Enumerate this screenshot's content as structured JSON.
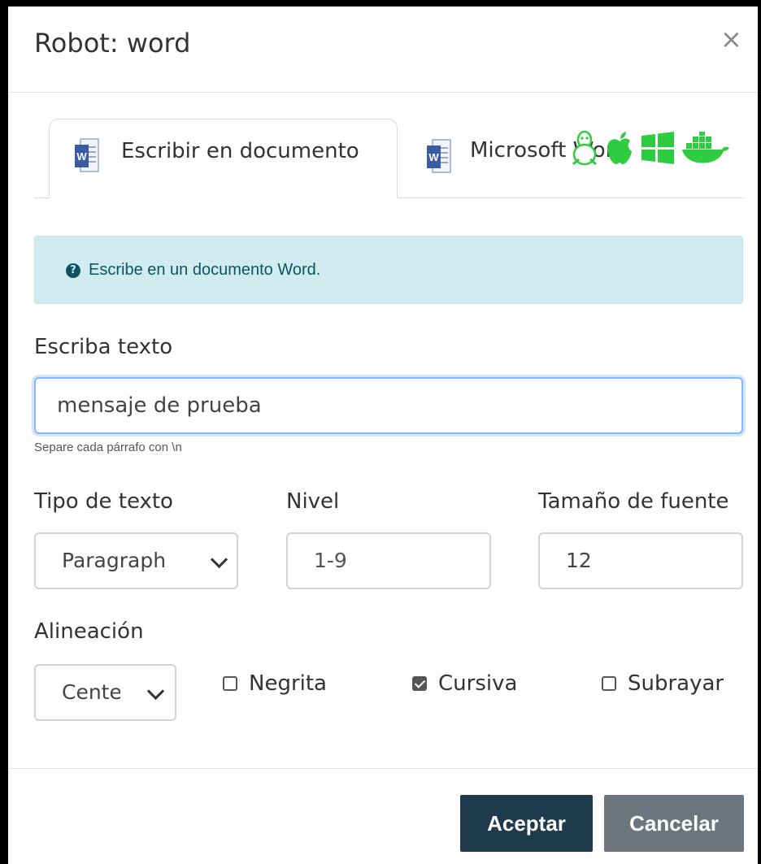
{
  "modal": {
    "title": "Robot: word",
    "close_label": "×"
  },
  "tabs": [
    {
      "label": "Escribir en documento",
      "icon": "word-icon",
      "active": true
    },
    {
      "label": "Microsoft Word",
      "icon": "word-icon",
      "active": false
    }
  ],
  "os_icons": [
    "linux-icon",
    "apple-icon",
    "windows-icon",
    "docker-icon"
  ],
  "colors": {
    "os_icon_green": "#2ecc40",
    "alert_bg": "#d1ecf1",
    "accept_bg": "#1f3a4d",
    "cancel_bg": "#6c757d"
  },
  "alert": {
    "icon": "?",
    "text": "Escribe en un documento Word."
  },
  "text_field": {
    "label": "Escriba texto",
    "value": "mensaje de prueba",
    "help": "Separe cada párrafo con \\n"
  },
  "text_type": {
    "label": "Tipo de texto",
    "value": "Paragraph"
  },
  "level": {
    "label": "Nivel",
    "placeholder": "1-9"
  },
  "font_size": {
    "label": "Tamaño de fuente",
    "value": "12"
  },
  "alignment": {
    "label": "Alineación",
    "value": "Cente"
  },
  "checkboxes": [
    {
      "label": "Negrita",
      "checked": false
    },
    {
      "label": "Cursiva",
      "checked": true
    },
    {
      "label": "Subrayar",
      "checked": false
    }
  ],
  "footer": {
    "accept_label": "Aceptar",
    "cancel_label": "Cancelar"
  }
}
